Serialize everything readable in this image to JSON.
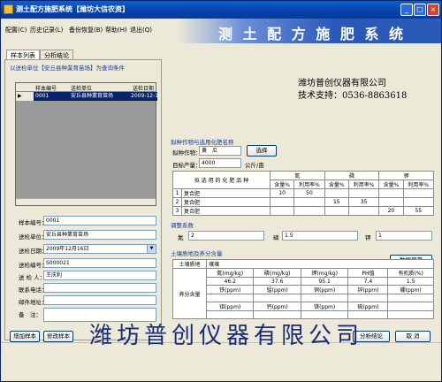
{
  "window": {
    "title": "测土配方施肥系统【潍坊大信农资】"
  },
  "menu": [
    "配置(C)",
    "历史记录(L)",
    "备份恢复(B)",
    "帮助(H)",
    "退出(Q)"
  ],
  "banner": {
    "title": "测 土 配 方 施 肥 系 统"
  },
  "tabs": [
    "样本列表",
    "分析结论"
  ],
  "left": {
    "filter_label": "以送检单位【安丘县种業育苗场】为查询条件",
    "grid_headers": [
      "样本编号",
      "送检单位",
      "送检日期"
    ],
    "grid_rows": [
      [
        "0001",
        "安丘县种業育苗场",
        "2009-12-16"
      ]
    ],
    "form": {
      "sample_no_label": "样本编号：",
      "sample_no": "0001",
      "unit_label": "送检单位：",
      "unit": "安丘县种業育苗场",
      "date_label": "送检日期：",
      "date": "2009年12月16日",
      "sample_no2_label": "送检编号：",
      "sample_no2": "S000021",
      "person_label": "送 检 人：",
      "person": "王庆利",
      "phone_label": "联系电话：",
      "phone": "",
      "address_label": "邮件地址：",
      "address": "",
      "note_label": "备　注：",
      "note": ""
    },
    "buttons": {
      "add": "增加样本",
      "modify": "修改样本"
    }
  },
  "right": {
    "company": "潍坊普创仪器有限公司",
    "support": "技术支持：0536-8863618",
    "crop_section": "拟种作物与选用化肥名称",
    "crop_label": "拟种作物：",
    "crop_value": "黄　瓜",
    "select_button": "选择",
    "target_label": "目标产量：",
    "target_value": "4000",
    "target_unit": "公斤/亩",
    "fert_table": {
      "header": "拟 选 用 的 化 肥 品 种",
      "groups": [
        "氮",
        "磷",
        "钾"
      ],
      "subs": [
        "含量%",
        "利用率%",
        "含量%",
        "利用率%",
        "含量%",
        "利用率%"
      ],
      "rows": [
        {
          "no": "1",
          "name": "复合肥",
          "vals": [
            "10",
            "50",
            "",
            "",
            "",
            ""
          ]
        },
        {
          "no": "2",
          "name": "复合肥",
          "vals": [
            "",
            "",
            "15",
            "35",
            "",
            ""
          ]
        },
        {
          "no": "3",
          "name": "复合肥",
          "vals": [
            "",
            "",
            "",
            "",
            "20",
            "55"
          ]
        }
      ]
    },
    "coef_section": "调整系数",
    "coef": [
      {
        "label": "氮",
        "value": "2"
      },
      {
        "label": "磷",
        "value": "1.5"
      },
      {
        "label": "钾",
        "value": "1"
      }
    ],
    "soil_section": "土壤质地及养分含量",
    "save_button": "数据保存",
    "soil_table": {
      "texture_label": "土壤质地",
      "texture_value": "壤壤",
      "nutrient_label": "养分含量",
      "row1_headers": [
        "氮(mg/kg)",
        "磷(mg/kg)",
        "钾(mg/kg)",
        "PH值",
        "有机质(%)"
      ],
      "row1_values": [
        "46.2",
        "37.6",
        "95.1",
        "7.4",
        "1.5"
      ],
      "row2_headers": [
        "铁(ppm)",
        "锰(ppm)",
        "铜(ppm)",
        "锌(ppm)",
        "硼(ppm)"
      ],
      "row2_values": [
        "",
        "",
        "",
        "",
        ""
      ],
      "row3_headers": [
        "钼(ppm)",
        "钙(ppm)",
        "镁(ppm)",
        "硫(ppm)",
        ""
      ],
      "row3_values": [
        "",
        "",
        "",
        "",
        ""
      ]
    },
    "analyze_button": "分析结论",
    "cancel_button": "取 消"
  },
  "watermark": "潍坊普创仪器有限公司"
}
